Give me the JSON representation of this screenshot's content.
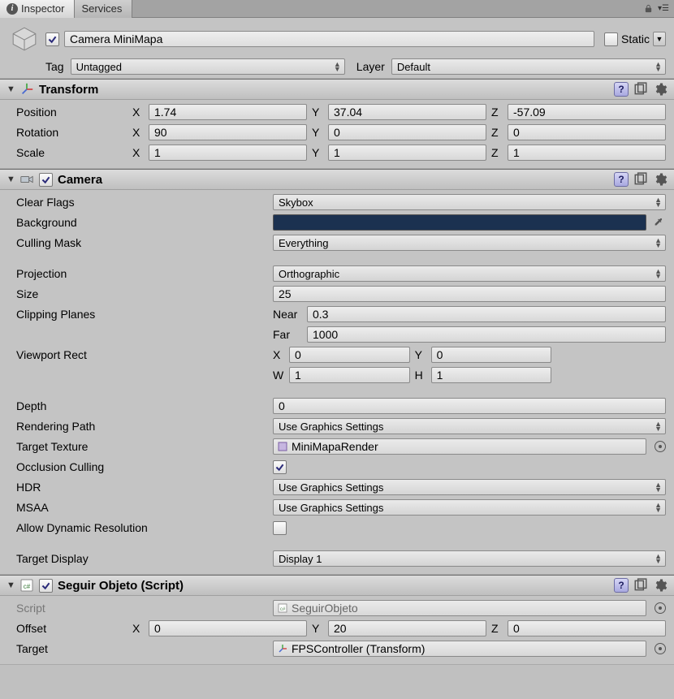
{
  "tabs": {
    "inspector": "Inspector",
    "services": "Services"
  },
  "header": {
    "name": "Camera MiniMapa",
    "static_label": "Static",
    "tag_label": "Tag",
    "tag_value": "Untagged",
    "layer_label": "Layer",
    "layer_value": "Default",
    "active_checked": true,
    "static_checked": false
  },
  "transform": {
    "title": "Transform",
    "position_label": "Position",
    "position": {
      "x": "1.74",
      "y": "37.04",
      "z": "-57.09"
    },
    "rotation_label": "Rotation",
    "rotation": {
      "x": "90",
      "y": "0",
      "z": "0"
    },
    "scale_label": "Scale",
    "scale": {
      "x": "1",
      "y": "1",
      "z": "1"
    },
    "axis": {
      "x": "X",
      "y": "Y",
      "z": "Z"
    }
  },
  "camera": {
    "title": "Camera",
    "enabled": true,
    "clear_flags_label": "Clear Flags",
    "clear_flags_value": "Skybox",
    "background_label": "Background",
    "background_color": "#1b3150",
    "culling_mask_label": "Culling Mask",
    "culling_mask_value": "Everything",
    "projection_label": "Projection",
    "projection_value": "Orthographic",
    "size_label": "Size",
    "size_value": "25",
    "clipping_label": "Clipping Planes",
    "near_label": "Near",
    "near_value": "0.3",
    "far_label": "Far",
    "far_value": "1000",
    "viewport_label": "Viewport Rect",
    "viewport": {
      "x": "0",
      "y": "0",
      "w": "1",
      "h": "1"
    },
    "axis": {
      "x": "X",
      "y": "Y",
      "w": "W",
      "h": "H"
    },
    "depth_label": "Depth",
    "depth_value": "0",
    "rendering_path_label": "Rendering Path",
    "rendering_path_value": "Use Graphics Settings",
    "target_texture_label": "Target Texture",
    "target_texture_value": "MiniMapaRender",
    "occlusion_label": "Occlusion Culling",
    "occlusion_checked": true,
    "hdr_label": "HDR",
    "hdr_value": "Use Graphics Settings",
    "msaa_label": "MSAA",
    "msaa_value": "Use Graphics Settings",
    "dynamic_res_label": "Allow Dynamic Resolution",
    "dynamic_res_checked": false,
    "target_display_label": "Target Display",
    "target_display_value": "Display 1"
  },
  "seguir": {
    "title": "Seguir Objeto (Script)",
    "enabled": true,
    "script_label": "Script",
    "script_value": "SeguirObjeto",
    "offset_label": "Offset",
    "offset": {
      "x": "0",
      "y": "20",
      "z": "0"
    },
    "target_label": "Target",
    "target_value": "FPSController (Transform)",
    "axis": {
      "x": "X",
      "y": "Y",
      "z": "Z"
    }
  }
}
